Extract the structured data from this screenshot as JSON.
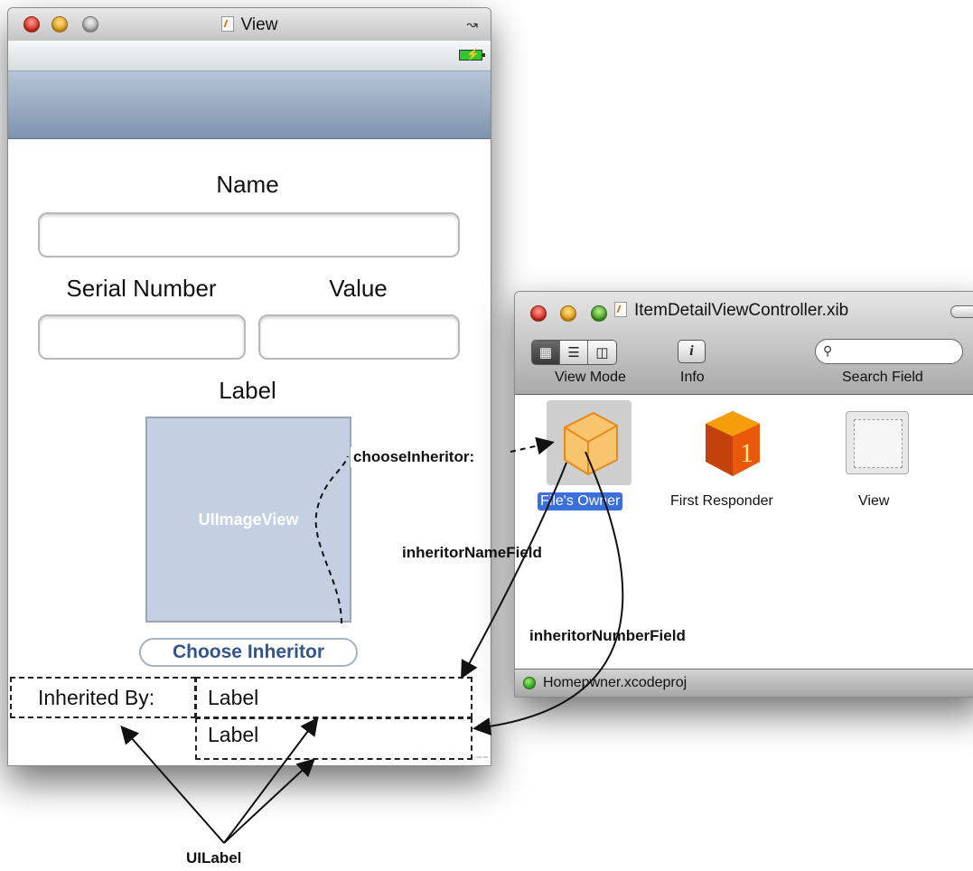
{
  "view_window": {
    "title": "View",
    "form": {
      "name_label": "Name",
      "serial_label": "Serial Number",
      "value_label": "Value",
      "image_label": "Label",
      "image_view_text": "UIImageView",
      "choose_button": "Choose Inheritor",
      "inherited_by_label": "Inherited By:",
      "inheritor_name_label": "Label",
      "inheritor_number_label": "Label"
    }
  },
  "xib_window": {
    "title": "ItemDetailViewController.xib",
    "toolbar": {
      "view_mode_caption": "View Mode",
      "info_caption": "Info",
      "search_caption": "Search Field",
      "info_glyph": "i"
    },
    "objects": [
      {
        "label": "File's Owner",
        "icon": "cube-icon",
        "selected": true
      },
      {
        "label": "First Responder",
        "icon": "first-responder-icon"
      },
      {
        "label": "View",
        "icon": "view-icon"
      }
    ],
    "status": "Homepwner.xcodeproj"
  },
  "annotations": {
    "choose_inheritor": "chooseInheritor:",
    "inheritor_name_field": "inheritorNameField",
    "inheritor_number_field": "inheritorNumberField",
    "ui_label": "UILabel"
  }
}
